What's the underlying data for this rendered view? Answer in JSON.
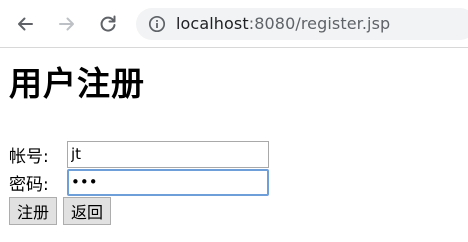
{
  "browser": {
    "back_icon": "arrow-left-icon",
    "forward_icon": "arrow-right-icon",
    "reload_icon": "reload-icon",
    "info_icon": "info-circle-icon",
    "url_host": "localhost",
    "url_rest": ":8080/register.jsp"
  },
  "page": {
    "title": "用户注册",
    "form": {
      "account_label": "帐号:",
      "account_value": "jt",
      "password_label": "密码:",
      "password_value": "123"
    },
    "buttons": {
      "register_label": "注册",
      "back_label": "返回"
    }
  }
}
